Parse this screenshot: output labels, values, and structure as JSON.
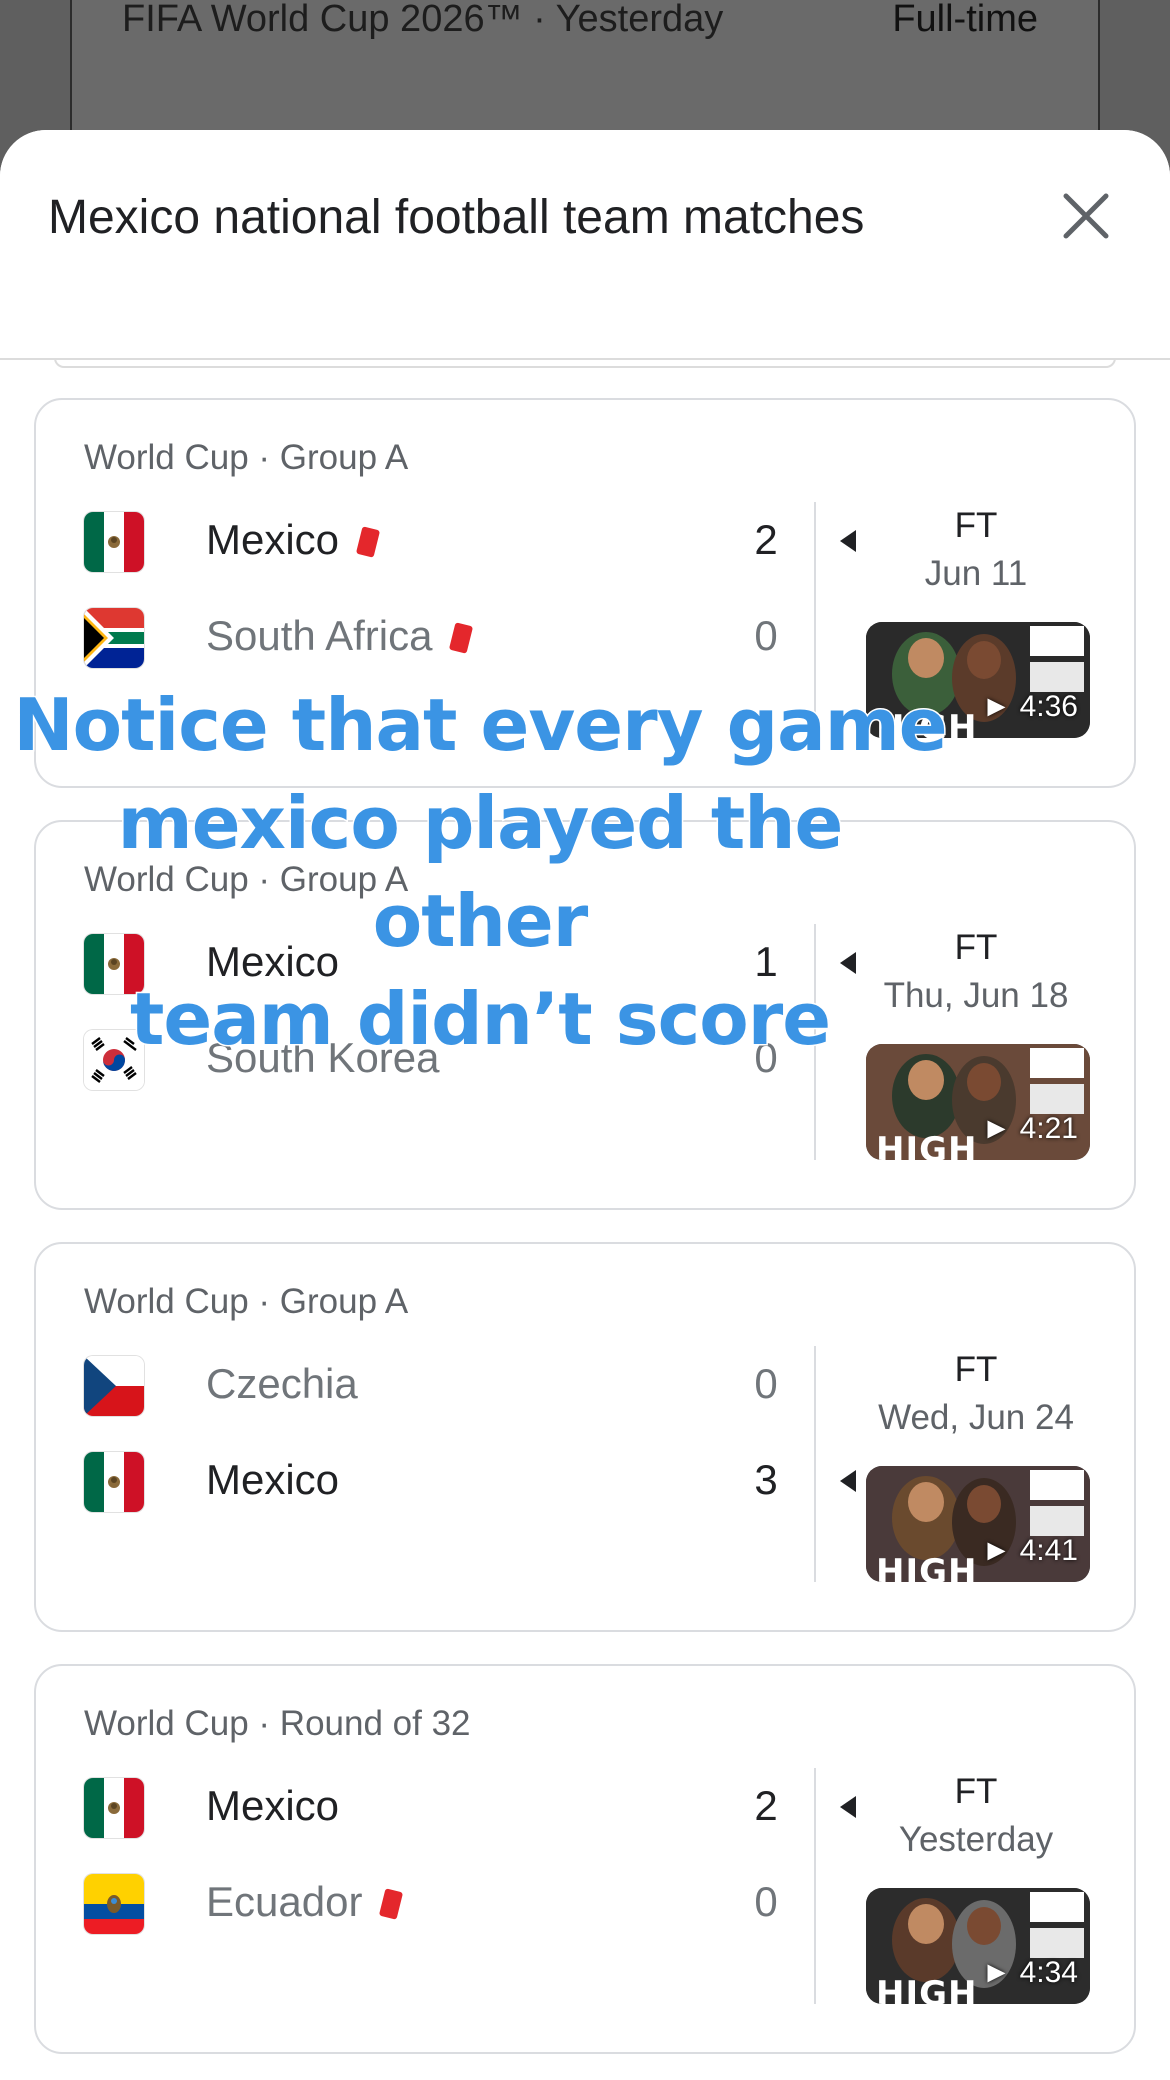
{
  "background_page": {
    "match_info": "FIFA World Cup 2026™ · Yesterday",
    "status": "Full-time"
  },
  "sheet": {
    "title": "Mexico national football team matches",
    "close_icon": "close-icon"
  },
  "matches": [
    {
      "competition": "World Cup · Group A",
      "team1": {
        "name": "Mexico",
        "score": "2",
        "flag": "mexico-flag-icon",
        "red_card": true,
        "winner": true
      },
      "team2": {
        "name": "South Africa",
        "score": "0",
        "flag": "south-africa-flag-icon",
        "red_card": true,
        "winner": false
      },
      "status": "FT",
      "date": "Jun 11",
      "highlights_label": "HIGH",
      "duration": "► 4:36"
    },
    {
      "competition": "World Cup · Group A",
      "team1": {
        "name": "Mexico",
        "score": "1",
        "flag": "mexico-flag-icon",
        "red_card": false,
        "winner": true
      },
      "team2": {
        "name": "South Korea",
        "score": "0",
        "flag": "south-korea-flag-icon",
        "red_card": false,
        "winner": false
      },
      "status": "FT",
      "date": "Thu, Jun 18",
      "highlights_label": "HIGH",
      "duration": "► 4:21"
    },
    {
      "competition": "World Cup · Group A",
      "team1": {
        "name": "Czechia",
        "score": "0",
        "flag": "czechia-flag-icon",
        "red_card": false,
        "winner": false
      },
      "team2": {
        "name": "Mexico",
        "score": "3",
        "flag": "mexico-flag-icon",
        "red_card": false,
        "winner": true
      },
      "status": "FT",
      "date": "Wed, Jun 24",
      "highlights_label": "HIGH",
      "duration": "► 4:41"
    },
    {
      "competition": "World Cup · Round of 32",
      "team1": {
        "name": "Mexico",
        "score": "2",
        "flag": "mexico-flag-icon",
        "red_card": false,
        "winner": true
      },
      "team2": {
        "name": "Ecuador",
        "score": "0",
        "flag": "ecuador-flag-icon",
        "red_card": true,
        "winner": false
      },
      "status": "FT",
      "date": "Yesterday",
      "highlights_label": "HIGH",
      "duration": "► 4:34"
    }
  ],
  "overlay_caption": {
    "line1": "Notice that every game",
    "line2": "mexico played the other",
    "line3": "team didn’t score"
  },
  "colors": {
    "accent_caption": "#3b94e4",
    "red_card": "#e4272c",
    "win_text": "#202124",
    "lose_text": "#70757a"
  }
}
